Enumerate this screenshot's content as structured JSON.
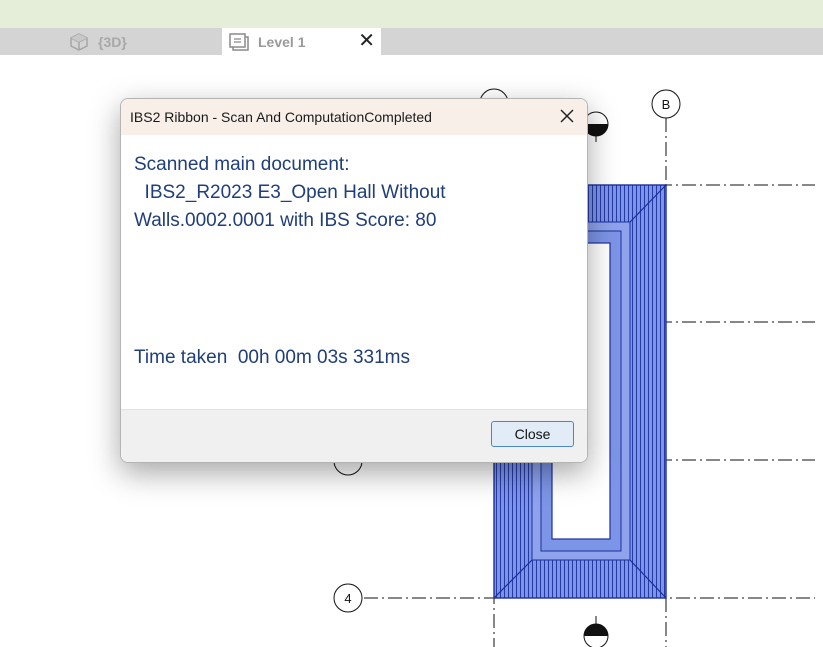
{
  "tabs": [
    {
      "label": "{3D}",
      "icon": "cube-3d-icon",
      "active": false
    },
    {
      "label": "Level 1",
      "icon": "floor-plan-icon",
      "active": true,
      "close": "✕"
    }
  ],
  "grid": {
    "column_bubble": "B",
    "row_bubble": "4"
  },
  "dialog": {
    "title": "IBS2 Ribbon - Scan And ComputationCompleted",
    "body_lines": [
      "Scanned main document:",
      "  IBS2_R2023 E3_Open Hall Without",
      "Walls.0002.0001 with IBS Score: 80"
    ],
    "time_text": "Time taken  00h 00m 03s 331ms",
    "close_button": "Close"
  },
  "colors": {
    "roof_fill": "#7d95e6",
    "roof_line": "#1c2f9e",
    "dialog_text": "#1f3e7a",
    "title_bar": "#f9efe9"
  }
}
